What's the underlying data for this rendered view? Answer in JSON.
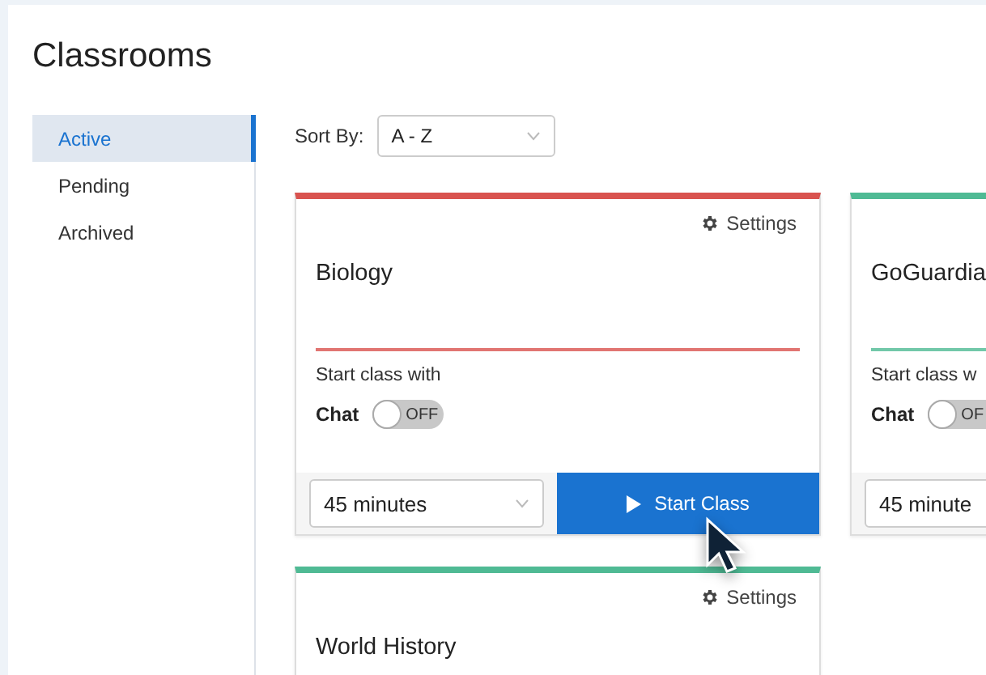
{
  "title": "Classrooms",
  "tabs": [
    {
      "label": "Active",
      "selected": true
    },
    {
      "label": "Pending",
      "selected": false
    },
    {
      "label": "Archived",
      "selected": false
    }
  ],
  "sort": {
    "label": "Sort By:",
    "value": "A - Z"
  },
  "classes": [
    {
      "name": "Biology",
      "color": "#d9534f",
      "settings": "Settings",
      "start_with": "Start class with",
      "chat_label": "Chat",
      "chat_on": false,
      "toggle_text": "OFF",
      "duration": "45 minutes",
      "button": "Start Class"
    },
    {
      "name": "GoGuardia",
      "color": "#4fba94",
      "start_with": "Start class w",
      "chat_label": "Chat",
      "chat_on": false,
      "toggle_text": "OF",
      "duration": "45 minute"
    },
    {
      "name": "World History",
      "color": "#4fba94",
      "settings": "Settings"
    }
  ]
}
